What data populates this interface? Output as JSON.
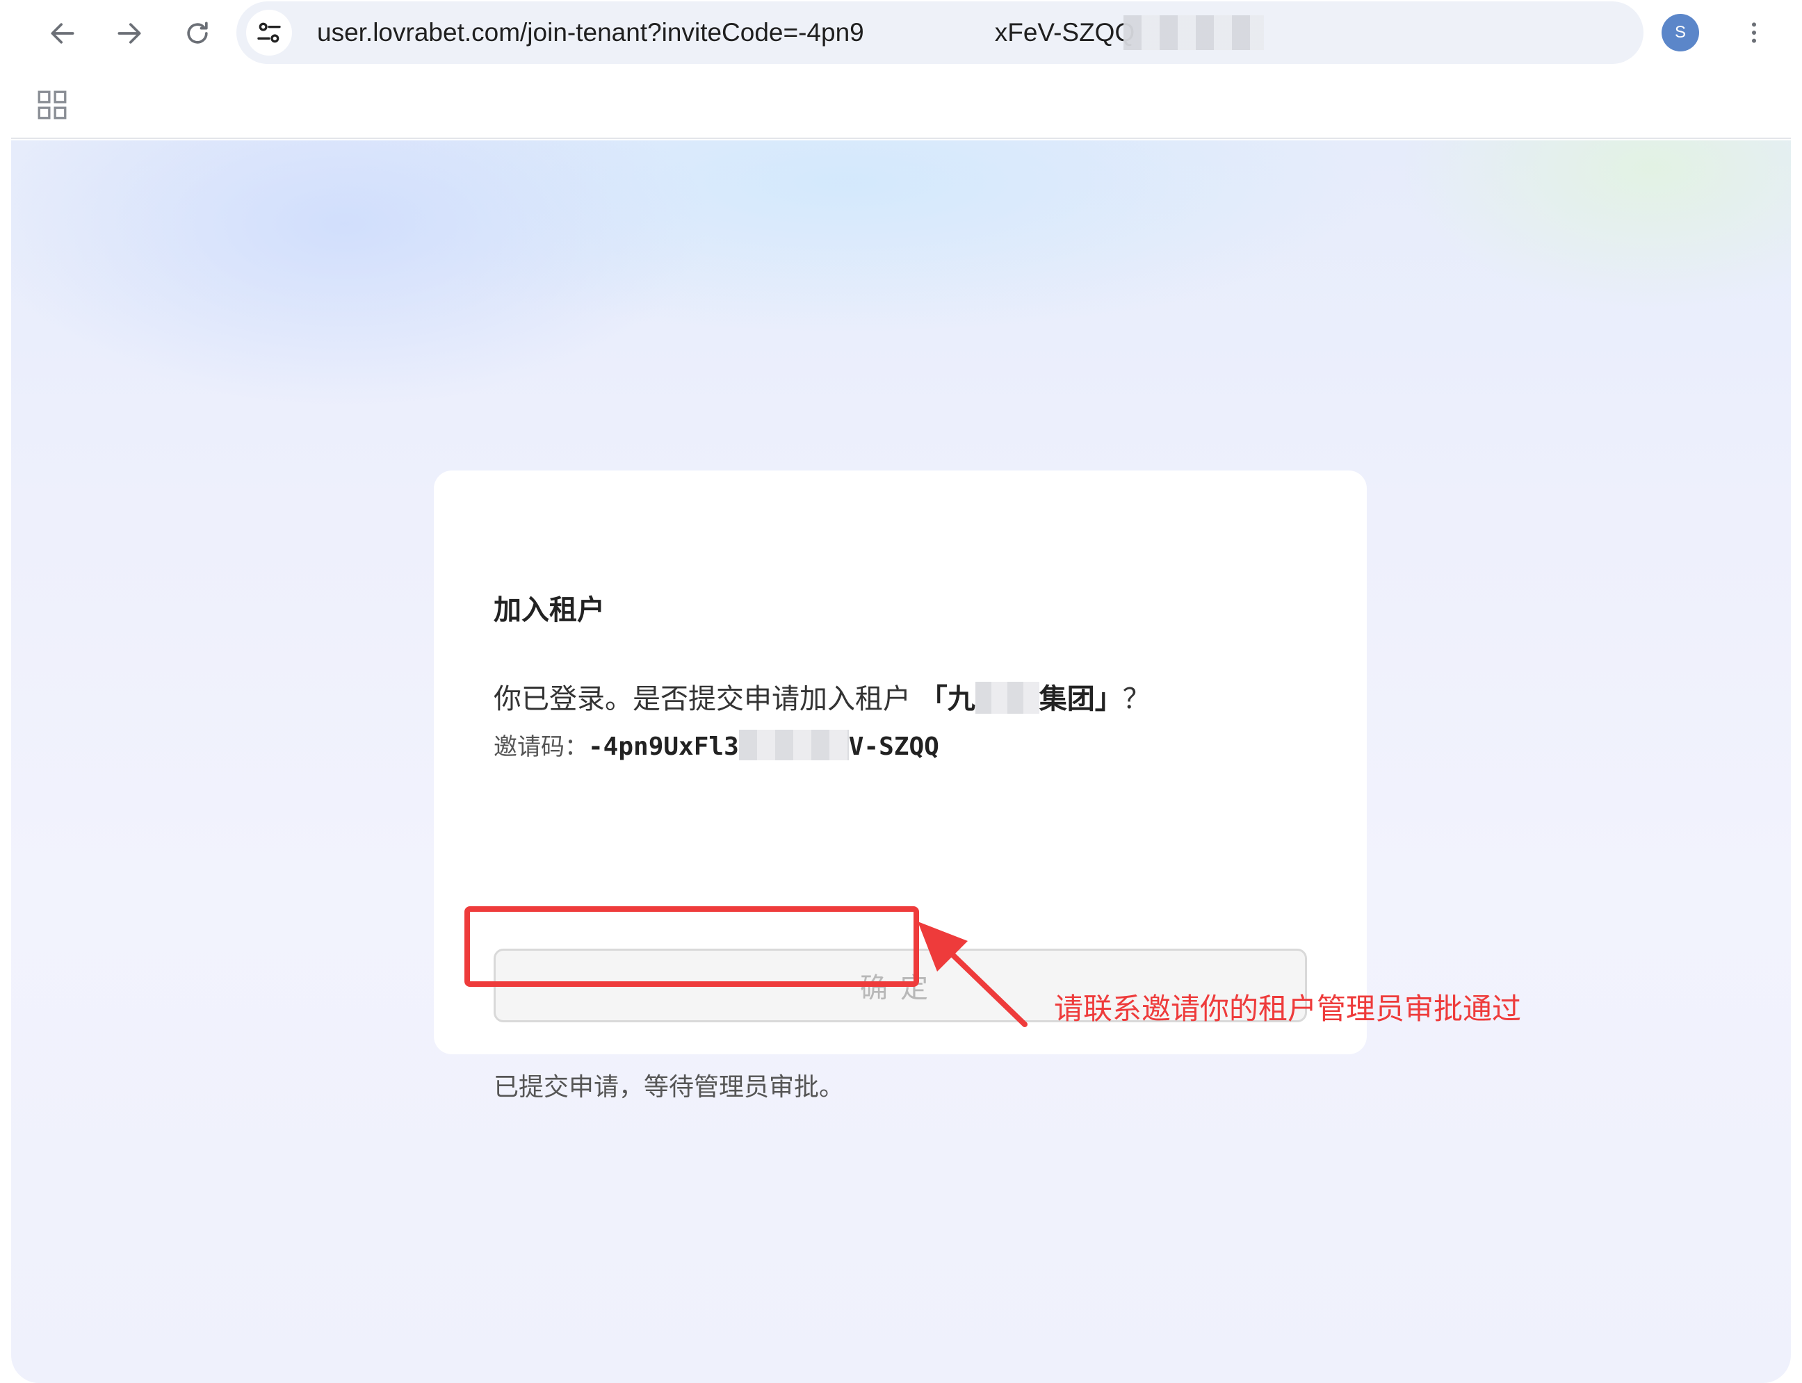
{
  "browser": {
    "url_prefix": "user.lovrabet.com/join-tenant?inviteCode=-4pn9",
    "url_suffix": "xFeV-SZQQ",
    "avatar_letter": "S",
    "icons": {
      "back": "arrow-left-icon",
      "forward": "arrow-right-icon",
      "reload": "reload-icon",
      "site_info": "tune-icon",
      "bookmark": "star-icon",
      "menu": "more-vert-icon",
      "apps": "apps-grid-icon"
    }
  },
  "card": {
    "title": "加入租户",
    "question_prefix": "你已登录。是否提交申请加入租户 ",
    "tenant_open": "「九",
    "tenant_close": "集团」",
    "question_suffix": "？",
    "invite_label": "邀请码：",
    "invite_code_prefix": "-4pn9UxFl3",
    "invite_code_suffix": "V-SZQQ",
    "confirm_label": "确定",
    "confirm_disabled": true,
    "status_message": "已提交申请，等待管理员审批。"
  },
  "annotation": {
    "text": "请联系邀请你的租户管理员审批通过",
    "color": "#ee3b3b"
  },
  "colors": {
    "avatar": "#5b86c9",
    "annotation_red": "#ee3b3b"
  }
}
